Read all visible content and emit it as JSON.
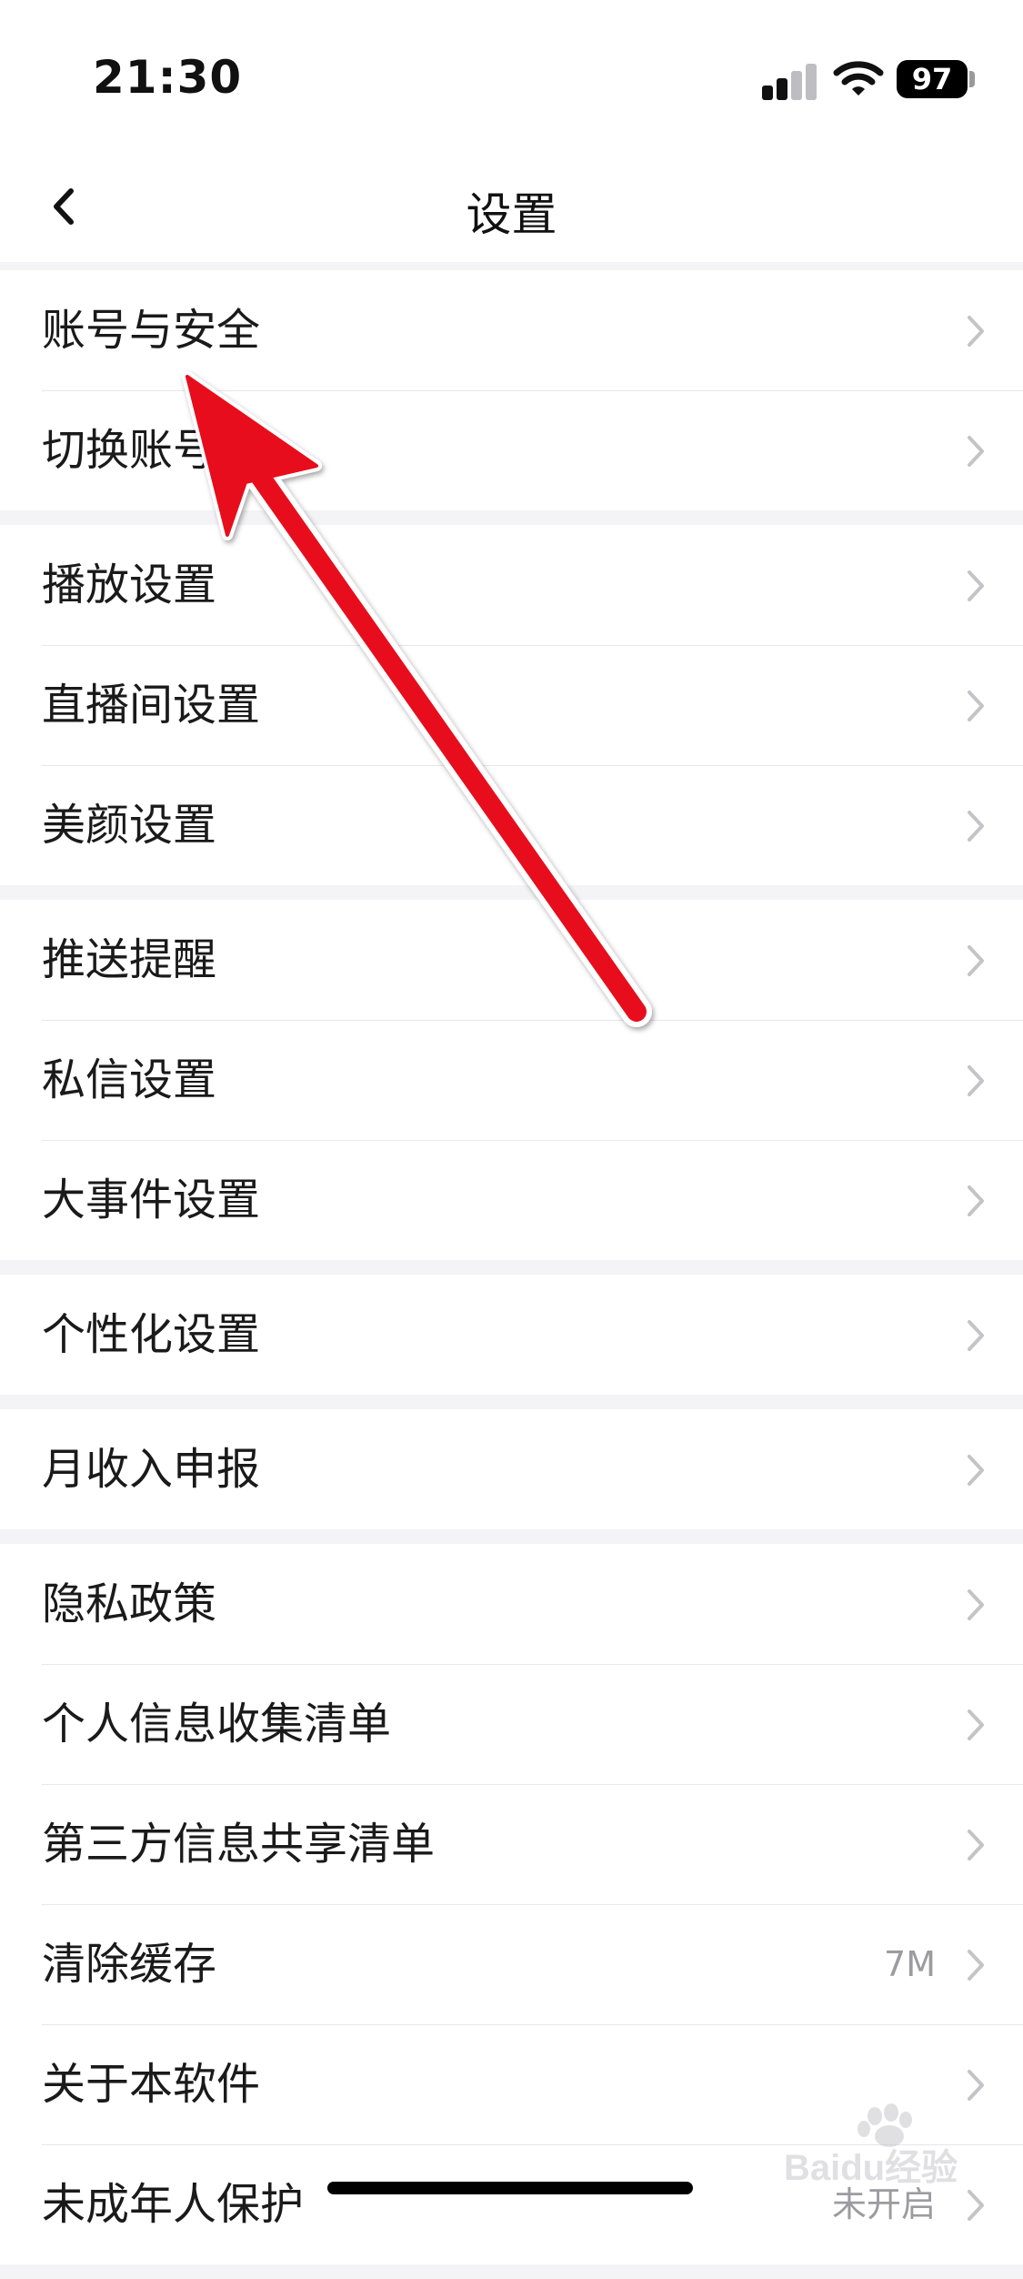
{
  "status_bar": {
    "time": "21:30",
    "battery": "97",
    "icons": [
      "cellular-signal-icon",
      "wifi-icon",
      "battery-icon"
    ]
  },
  "nav": {
    "title": "设置",
    "back_icon": "chevron-left-icon"
  },
  "groups": [
    {
      "items": [
        {
          "label": "账号与安全"
        },
        {
          "label": "切换账号"
        }
      ]
    },
    {
      "items": [
        {
          "label": "播放设置"
        },
        {
          "label": "直播间设置"
        },
        {
          "label": "美颜设置"
        }
      ]
    },
    {
      "items": [
        {
          "label": "推送提醒"
        },
        {
          "label": "私信设置"
        },
        {
          "label": "大事件设置"
        }
      ]
    },
    {
      "items": [
        {
          "label": "个性化设置"
        }
      ]
    },
    {
      "items": [
        {
          "label": "月收入申报"
        }
      ]
    },
    {
      "items": [
        {
          "label": "隐私政策"
        },
        {
          "label": "个人信息收集清单"
        },
        {
          "label": "第三方信息共享清单"
        },
        {
          "label": "清除缓存",
          "value": "7M"
        },
        {
          "label": "关于本软件"
        },
        {
          "label": "未成年人保护",
          "value": "未开启"
        }
      ]
    }
  ],
  "colors": {
    "background": "#f4f4f6",
    "annotation_arrow": "#e8101a",
    "chevron": "#c4c4c8"
  },
  "watermark": {
    "text": "Baidu经验",
    "icon": "baidu-paw-icon"
  }
}
